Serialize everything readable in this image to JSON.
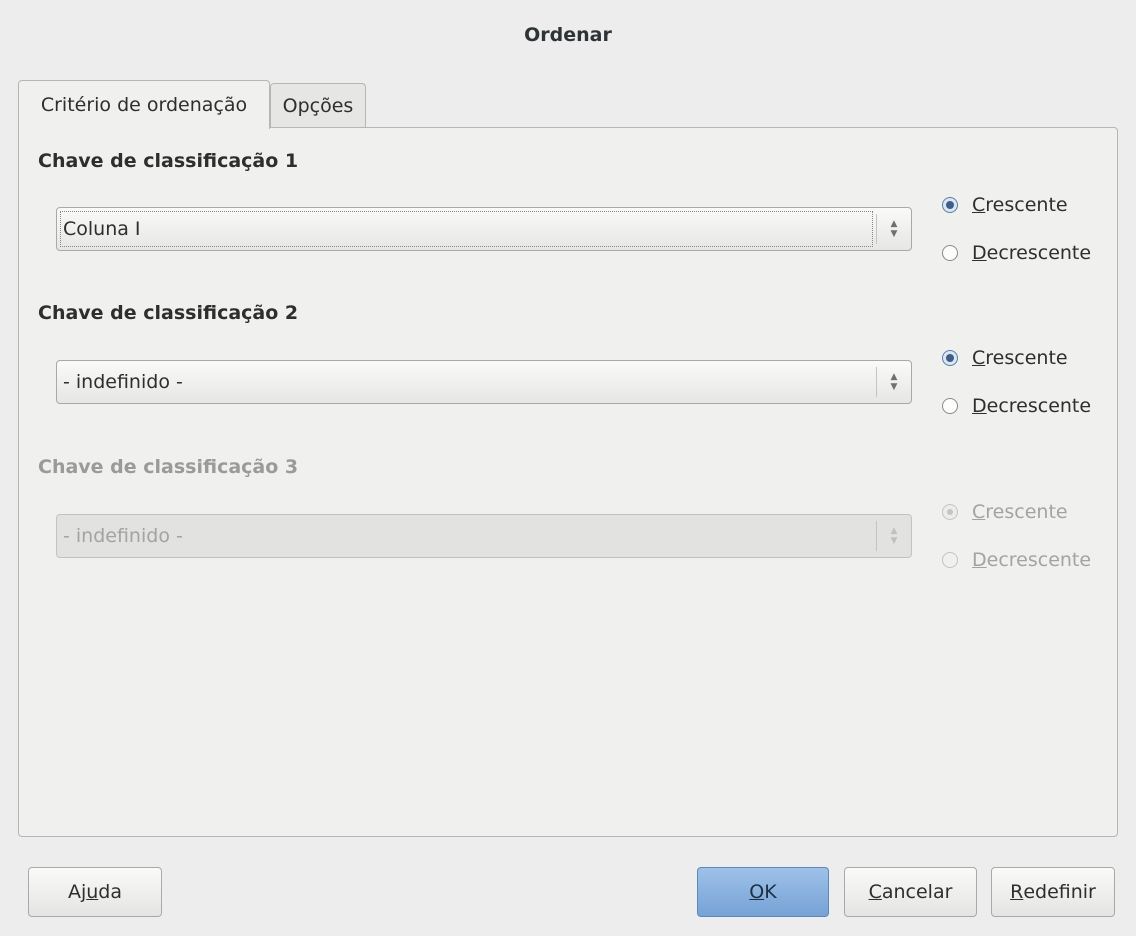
{
  "window": {
    "title": "Ordenar"
  },
  "tabs": [
    {
      "label": "Critério de ordenação",
      "active": true
    },
    {
      "label": "Opções",
      "active": false
    }
  ],
  "sort_keys": [
    {
      "label": "Chave de classificação 1",
      "value": "Coluna I",
      "enabled": true,
      "ascending": {
        "mnemonic": "C",
        "rest": "rescente",
        "checked": true
      },
      "descending": {
        "mnemonic": "D",
        "rest": "ecrescente",
        "checked": false
      }
    },
    {
      "label": "Chave de classificação 2",
      "value": "- indefinido -",
      "enabled": true,
      "ascending": {
        "mnemonic": "C",
        "rest": "rescente",
        "checked": true
      },
      "descending": {
        "mnemonic": "D",
        "rest": "ecrescente",
        "checked": false
      }
    },
    {
      "label": "Chave de classificação 3",
      "value": "- indefinido -",
      "enabled": false,
      "ascending": {
        "mnemonic": "C",
        "rest": "rescente",
        "checked": true
      },
      "descending": {
        "mnemonic": "D",
        "rest": "ecrescente",
        "checked": false
      }
    }
  ],
  "buttons": {
    "help": {
      "pre": "Aj",
      "mnemonic": "u",
      "post": "da"
    },
    "ok": {
      "pre": "",
      "mnemonic": "O",
      "post": "K"
    },
    "cancel": {
      "pre": "",
      "mnemonic": "C",
      "post": "ancelar"
    },
    "reset": {
      "pre": "",
      "mnemonic": "R",
      "post": "edefinir"
    }
  },
  "colors": {
    "accent": "#76a2d6",
    "background": "#ededed",
    "disabled_text": "#a3a3a1"
  },
  "icons": {
    "spin_up": "up-arrow-icon",
    "spin_down": "down-arrow-icon"
  }
}
